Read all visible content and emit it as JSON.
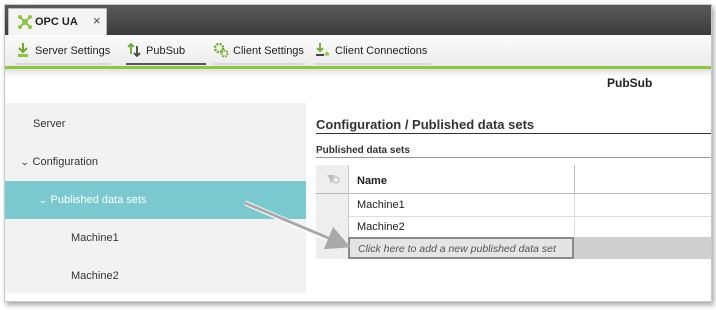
{
  "tab": {
    "label": "OPC UA",
    "close": "×",
    "icon": "opcua-network-icon"
  },
  "toolbar": {
    "server_settings": "Server Settings",
    "pubsub": "PubSub",
    "client_settings": "Client Settings",
    "client_connections": "Client Connections"
  },
  "page_title": "PubSub",
  "sidebar": {
    "items": [
      {
        "label": "Server"
      },
      {
        "label": "Configuration"
      },
      {
        "label": "Published data sets"
      },
      {
        "label": "Machine1"
      },
      {
        "label": "Machine2"
      }
    ]
  },
  "main": {
    "title": "Configuration / Published data sets",
    "subtitle": "Published data sets",
    "grid": {
      "columns": [
        "Name"
      ],
      "rows": [
        {
          "name": "Machine1"
        },
        {
          "name": "Machine2"
        }
      ],
      "add_row_text": "Click here to add a new published data set"
    }
  },
  "colors": {
    "accent": "#8dc63f",
    "selection": "#79c9cf"
  }
}
